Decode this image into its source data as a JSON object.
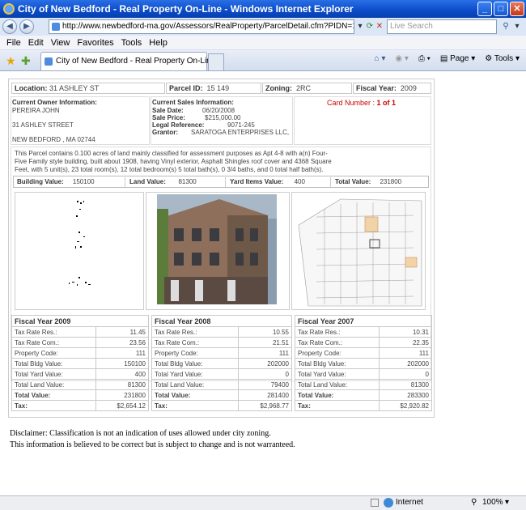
{
  "window": {
    "title": "City of New Bedford - Real Property On-Line - Windows Internet Explorer"
  },
  "address_bar": {
    "url": "http://www.newbedford-ma.gov/Assessors/RealProperty/ParcelDetail.cfm?PIDN=15 149&CNO=1",
    "search_placeholder": "Live Search"
  },
  "menu": [
    "File",
    "Edit",
    "View",
    "Favorites",
    "Tools",
    "Help"
  ],
  "tab": {
    "label": "City of New Bedford - Real Property On-Line"
  },
  "toolbar": {
    "page_label": "Page",
    "tools_label": "Tools"
  },
  "parcel": {
    "location_label": "Location:",
    "location": "31 ASHLEY ST",
    "parcel_id_label": "Parcel ID:",
    "parcel_id": "15 149",
    "zoning_label": "Zoning:",
    "zoning": "2RC",
    "fiscal_year_label": "Fiscal Year:",
    "fiscal_year": "2009"
  },
  "owner": {
    "heading": "Current Owner Information:",
    "name": "PEREIRA JOHN",
    "street": "31 ASHLEY STREET",
    "city": "NEW BEDFORD , MA 02744"
  },
  "sales": {
    "heading": "Current Sales Information:",
    "sale_date_label": "Sale Date:",
    "sale_date": "06/20/2008",
    "sale_price_label": "Sale Price:",
    "sale_price": "$215,000.00",
    "legal_ref_label": "Legal Reference:",
    "legal_ref": "9071-245",
    "grantor_label": "Grantor:",
    "grantor": "SARATOGA ENTERPRISES LLC,"
  },
  "card": {
    "label": "Card Number :",
    "value": "1 of 1"
  },
  "description": {
    "line1": "This Parcel contains 0.100 acres of land mainly classified for assessment purposes as Apt 4-8 with a(n) Four-",
    "line2": "Five Family style building, built about 1908, having Vinyl exterior, Asphalt Shingles roof cover and 4368 Square",
    "line3": "Feet, with 5 unit(s), 23 total room(s), 12 total bedroom(s) 5 total bath(s), 0 3/4 baths, and 0 total half bath(s)."
  },
  "values": {
    "building_label": "Building Value:",
    "building": "150100",
    "land_label": "Land Value:",
    "land": "81300",
    "yard_label": "Yard Items Value:",
    "yard": "400",
    "total_label": "Total Value:",
    "total": "231800"
  },
  "fiscal_years": [
    {
      "title": "Fiscal Year 2009",
      "rows": [
        {
          "k": "Tax Rate Res.:",
          "v": "11.45"
        },
        {
          "k": "Tax Rate Com.:",
          "v": "23.56"
        },
        {
          "k": "Property Code:",
          "v": "111"
        },
        {
          "k": "Total Bldg Value:",
          "v": "150100"
        },
        {
          "k": "Total Yard Value:",
          "v": "400"
        },
        {
          "k": "Total Land Value:",
          "v": "81300"
        },
        {
          "k": "Total Value:",
          "v": "231800"
        },
        {
          "k": "Tax:",
          "v": "$2,654.12"
        }
      ]
    },
    {
      "title": "Fiscal Year 2008",
      "rows": [
        {
          "k": "Tax Rate Res.:",
          "v": "10.55"
        },
        {
          "k": "Tax Rate Com.:",
          "v": "21.51"
        },
        {
          "k": "Property Code:",
          "v": "111"
        },
        {
          "k": "Total Bldg Value:",
          "v": "202000"
        },
        {
          "k": "Total Yard Value:",
          "v": "0"
        },
        {
          "k": "Total Land Value:",
          "v": "79400"
        },
        {
          "k": "Total Value:",
          "v": "281400"
        },
        {
          "k": "Tax:",
          "v": "$2,968.77"
        }
      ]
    },
    {
      "title": "Fiscal Year 2007",
      "rows": [
        {
          "k": "Tax Rate Res.:",
          "v": "10.31"
        },
        {
          "k": "Tax Rate Com.:",
          "v": "22.35"
        },
        {
          "k": "Property Code:",
          "v": "111"
        },
        {
          "k": "Total Bldg Value:",
          "v": "202000"
        },
        {
          "k": "Total Yard Value:",
          "v": "0"
        },
        {
          "k": "Total Land Value:",
          "v": "81300"
        },
        {
          "k": "Total Value:",
          "v": "283300"
        },
        {
          "k": "Tax:",
          "v": "$2,920.82"
        }
      ]
    }
  ],
  "disclaimer": {
    "line1": "Disclaimer: Classification is not an indication of uses allowed under city zoning.",
    "line2": "This information is believed to be correct but is subject to change and is not warranteed."
  },
  "status": {
    "zone": "Internet",
    "zoom": "100%"
  },
  "colors": {
    "accent": "#0a4bc9",
    "card_red": "#cc0000"
  }
}
